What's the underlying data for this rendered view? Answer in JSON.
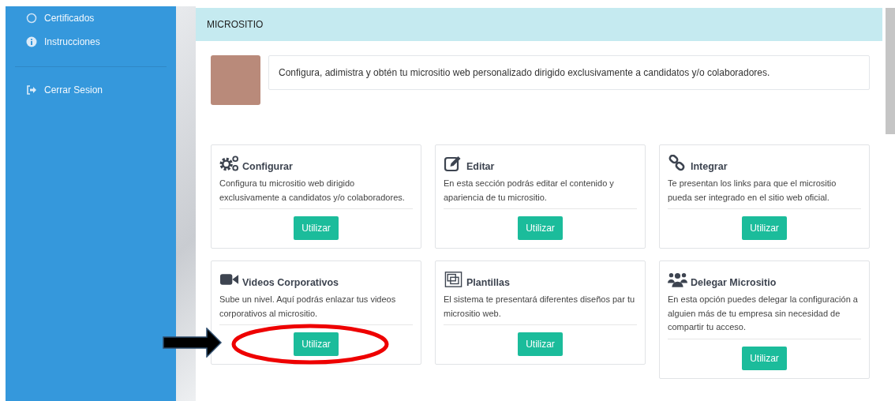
{
  "sidebar": {
    "items": [
      {
        "label": "Certificados",
        "kind": "certificate"
      },
      {
        "label": "Instrucciones",
        "kind": "info"
      }
    ],
    "footer_items": [
      {
        "label": "Cerrar Sesion",
        "kind": "logout"
      }
    ]
  },
  "panel": {
    "title": "MICROSITIO",
    "intro": "Configura, adimistra y obtén tu micrositio web personalizado dirigido exclusivamente a candidatos y/o colaboradores.",
    "cards": [
      {
        "kind": "gears",
        "title": "Configurar",
        "description": "Configura tu micrositio web dirigido exclusivamente a candidatos y/o colaboradores.",
        "button": "Utilizar",
        "highlighted": false
      },
      {
        "kind": "edit",
        "title": "Editar",
        "description": "En esta sección podrás editar el contenido y apariencia de tu micrositio.",
        "button": "Utilizar",
        "highlighted": false
      },
      {
        "kind": "link",
        "title": "Integrar",
        "description": "Te presentan los links para que el micrositio pueda ser integrado en el sitio web oficial.",
        "button": "Utilizar",
        "highlighted": false
      },
      {
        "kind": "video",
        "title": "Videos Corporativos",
        "description": "Sube un nivel. Aquí podrás enlazar tus videos corporativos al micrositio.",
        "button": "Utilizar",
        "highlighted": true
      },
      {
        "kind": "templates",
        "title": "Plantillas",
        "description": "El sistema te presentará diferentes diseños par tu micrositio web.",
        "button": "Utilizar",
        "highlighted": false
      },
      {
        "kind": "users",
        "title": "Delegar Micrositio",
        "description": "En esta opción puedes delegar la configuración a alguien más de tu empresa sin necesidad de compartir tu acceso.",
        "button": "Utilizar",
        "highlighted": false
      }
    ]
  }
}
